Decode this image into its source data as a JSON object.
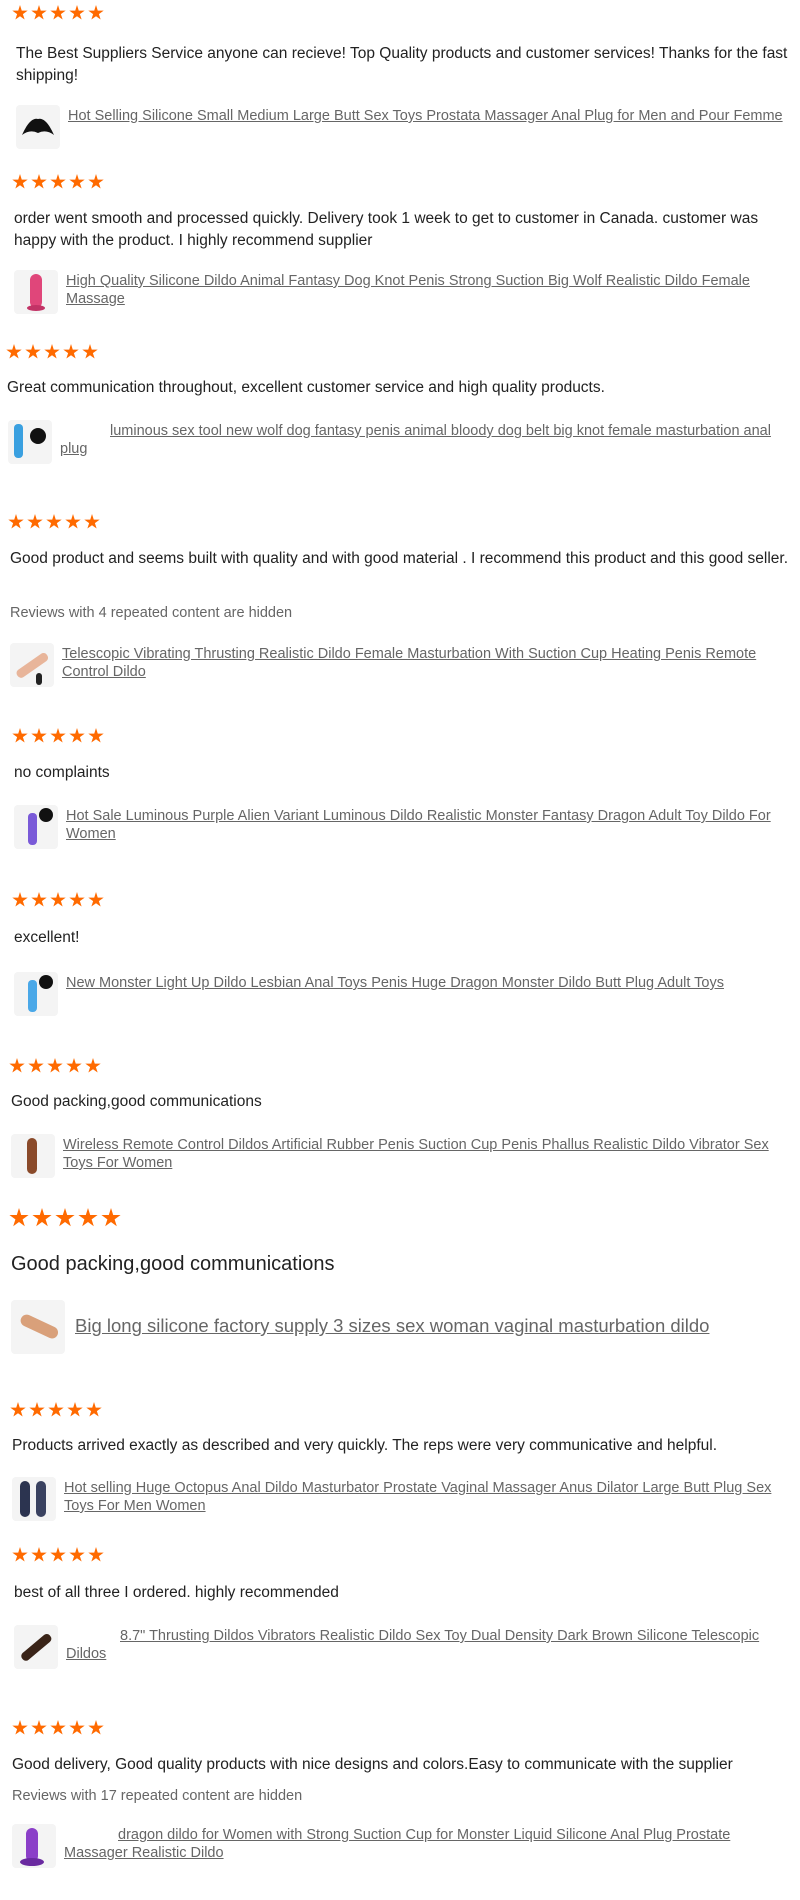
{
  "accent_color": "#ff6a00",
  "reviews": [
    {
      "rating": 5,
      "text": "The Best Suppliers Service anyone can recieve! Top Quality products and customer services! Thanks for the fast shipping!",
      "hidden_note": "",
      "product_icon": "black-plug-icon",
      "product_title": "Hot Selling Silicone Small Medium Large Butt Sex Toys Prostata Massager Anal Plug for Men and Pour Femme"
    },
    {
      "rating": 5,
      "text": "order went smooth and processed quickly. Delivery took 1 week to get to customer in Canada. customer was happy with the product. I highly recommend supplier",
      "hidden_note": "",
      "product_icon": "pink-dildo-icon",
      "product_title": "High Quality Silicone Dildo Animal Fantasy Dog Knot Penis Strong Suction Big Wolf Realistic Dildo Female Massage"
    },
    {
      "rating": 5,
      "text": "Great communication throughout, excellent customer service and high quality products.",
      "hidden_note": "",
      "product_icon": "blue-dildo-icon",
      "product_title": "luminous sex tool new wolf dog fantasy penis animal bloody dog belt big knot female masturbation anal plug"
    },
    {
      "rating": 5,
      "text": "Good product and seems built with quality and with good material . I recommend this product and this good seller.",
      "hidden_note": "Reviews with 4 repeated content are hidden",
      "product_icon": "telescopic-dildo-icon",
      "product_title": "Telescopic Vibrating Thrusting Realistic Dildo Female Masturbation With Suction Cup Heating Penis Remote Control Dildo"
    },
    {
      "rating": 5,
      "text": "no complaints",
      "hidden_note": "",
      "product_icon": "luminous-dildo-icon",
      "product_title": "Hot Sale Luminous Purple Alien Variant Luminous Dildo Realistic Monster Fantasy Dragon Adult Toy Dildo For Women"
    },
    {
      "rating": 5,
      "text": "excellent!",
      "hidden_note": "",
      "product_icon": "light-up-dildo-icon",
      "product_title": "New Monster Light Up Dildo Lesbian Anal Toys Penis Huge Dragon Monster Dildo Butt Plug Adult Toys"
    },
    {
      "rating": 5,
      "text": "Good packing,good communications",
      "hidden_note": "",
      "product_icon": "brown-dildo-icon",
      "product_title": "Wireless Remote Control Dildos Artificial Rubber Penis Suction Cup Penis Phallus Realistic Dildo Vibrator Sex Toys For Women"
    },
    {
      "rating": 5,
      "text": "Good packing,good communications",
      "hidden_note": "",
      "product_icon": "beige-dildo-icon",
      "product_title": "Big long silicone factory supply 3 sizes sex woman vaginal masturbation dildo"
    },
    {
      "rating": 5,
      "text": "Products arrived exactly as described and very quickly. The reps were very communicative and helpful.",
      "hidden_note": "",
      "product_icon": "octopus-dildo-icon",
      "product_title": "Hot selling Huge Octopus Anal Dildo Masturbator Prostate Vaginal Massager Anus Dilator Large Butt Plug Sex Toys For Men Women"
    },
    {
      "rating": 5,
      "text": "best of all three I ordered. highly recommended",
      "hidden_note": "",
      "product_icon": "dark-brown-dildo-icon",
      "product_title": "8.7\" Thrusting Dildos Vibrators Realistic Dildo Sex Toy Dual Density Dark Brown Silicone Telescopic Dildos"
    },
    {
      "rating": 5,
      "text": "Good delivery, Good quality products with nice designs and colors.Easy to communicate with the supplier",
      "hidden_note": "Reviews with 17 repeated content are hidden",
      "product_icon": "purple-dragon-dildo-icon",
      "product_title": "dragon dildo for Women with Strong Suction Cup for Monster Liquid Silicone Anal Plug Prostate Massager Realistic Dildo"
    }
  ]
}
